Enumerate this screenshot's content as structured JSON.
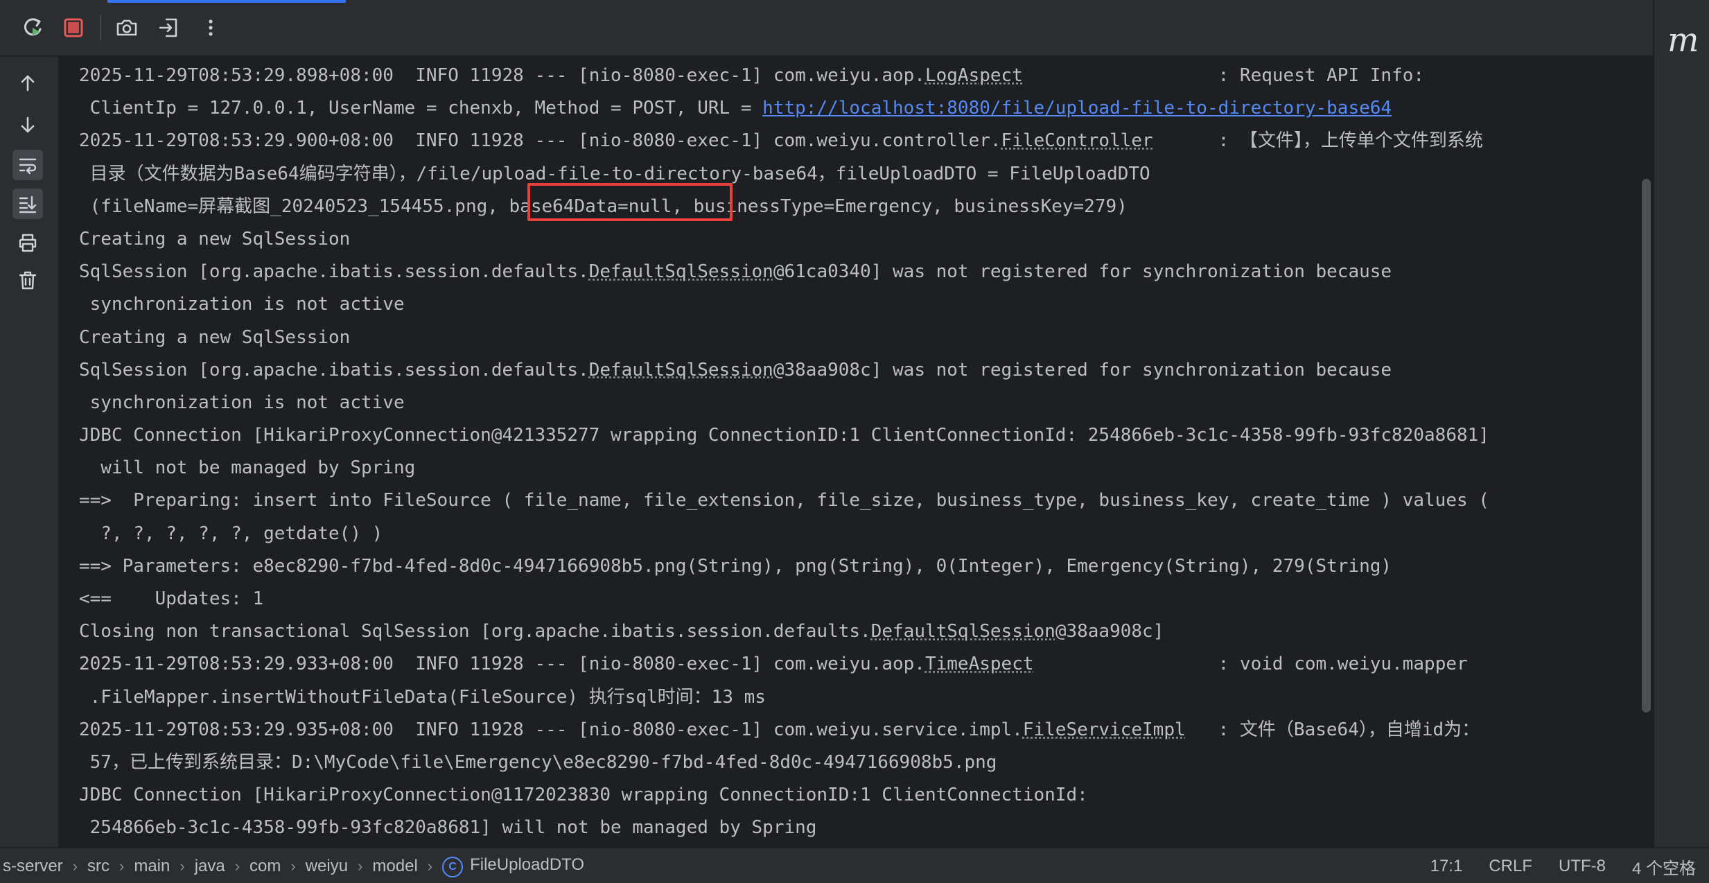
{
  "toolbar": {
    "accent_color": "#3574f0",
    "buttons": [
      {
        "name": "rerun-icon"
      },
      {
        "name": "stop-icon"
      },
      {
        "name": "camera-icon"
      },
      {
        "name": "exit-icon"
      },
      {
        "name": "more-icon"
      }
    ]
  },
  "right_panel": {
    "label": "m"
  },
  "gutter": {
    "icons": [
      "arrow-up-icon",
      "arrow-down-icon",
      "soft-wrap-icon",
      "scroll-to-end-icon",
      "print-icon",
      "trash-icon"
    ]
  },
  "console": {
    "lines": [
      [
        "2025-11-29T08:53:29.898+08:00  INFO 11928 --- [nio-8080-exec-1] com.weiyu.aop.",
        "LogAspect",
        "                  : Request API Info:"
      ],
      [
        " ClientIp = 127.0.0.1, UserName = chenxb, Method = POST, URL = ",
        "http://localhost:8080/file/upload-file-to-directory-base64",
        ""
      ],
      [
        "2025-11-29T08:53:29.900+08:00  INFO 11928 --- [nio-8080-exec-1] com.weiyu.controller.",
        "FileController",
        "      : 【文件】，上传单个文件到系统"
      ],
      [
        " 目录（文件数据为Base64编码字符串），/file/upload-file-to-directory-base64，fileUploadDTO = FileUploadDTO",
        "",
        ""
      ],
      [
        " (fileName=屏幕截图_20240523_154455.png, base64Data=null, businessType=Emergency, businessKey=279)",
        "",
        ""
      ],
      [
        "Creating a new SqlSession",
        "",
        ""
      ],
      [
        "SqlSession [org.apache.ibatis.session.defaults.",
        "DefaultSqlSession",
        "@61ca0340] was not registered for synchronization because"
      ],
      [
        " synchronization is not active",
        "",
        ""
      ],
      [
        "Creating a new SqlSession",
        "",
        ""
      ],
      [
        "SqlSession [org.apache.ibatis.session.defaults.",
        "DefaultSqlSession",
        "@38aa908c] was not registered for synchronization because"
      ],
      [
        " synchronization is not active",
        "",
        ""
      ],
      [
        "JDBC Connection [HikariProxyConnection@421335277 wrapping ConnectionID:1 ClientConnectionId: 254866eb-3c1c-4358-99fb-93fc820a8681]",
        "",
        ""
      ],
      [
        "  will not be managed by Spring",
        "",
        ""
      ],
      [
        "==>  Preparing: insert into FileSource ( file_name, file_extension, file_size, business_type, business_key, create_time ) values (",
        "",
        ""
      ],
      [
        "  ?, ?, ?, ?, ?, getdate() )",
        "",
        ""
      ],
      [
        "==> Parameters: e8ec8290-f7bd-4fed-8d0c-4947166908b5.png(String), png(String), 0(Integer), Emergency(String), 279(String)",
        "",
        ""
      ],
      [
        "<==    Updates: 1",
        "",
        ""
      ],
      [
        "Closing non transactional SqlSession [org.apache.ibatis.session.defaults.",
        "DefaultSqlSession",
        "@38aa908c]"
      ],
      [
        "2025-11-29T08:53:29.933+08:00  INFO 11928 --- [nio-8080-exec-1] com.weiyu.aop.",
        "TimeAspect",
        "                 : void com.weiyu.mapper"
      ],
      [
        " .FileMapper.insertWithoutFileData(FileSource) 执行sql时间：13 ms",
        "",
        ""
      ],
      [
        "2025-11-29T08:53:29.935+08:00  INFO 11928 --- [nio-8080-exec-1] com.weiyu.service.impl.",
        "FileServiceImpl",
        "   : 文件（Base64），自增id为："
      ],
      [
        " 57，已上传到系统目录：D:\\MyCode\\file\\Emergency\\e8ec8290-f7bd-4fed-8d0c-4947166908b5.png",
        "",
        ""
      ],
      [
        "JDBC Connection [HikariProxyConnection@1172023830 wrapping ConnectionID:1 ClientConnectionId:",
        "",
        ""
      ],
      [
        " 254866eb-3c1c-4358-99fb-93fc820a8681] will not be managed by Spring",
        "",
        ""
      ]
    ],
    "link_line_index": 1,
    "highlight_color": "#e8413c"
  },
  "statusbar": {
    "breadcrumbs": [
      "s-server",
      "src",
      "main",
      "java",
      "com",
      "weiyu",
      "model"
    ],
    "class_icon_letter": "C",
    "current_class": "FileUploadDTO",
    "position": "17:1",
    "line_separator": "CRLF",
    "encoding": "UTF-8",
    "indent": "4 个空格"
  }
}
